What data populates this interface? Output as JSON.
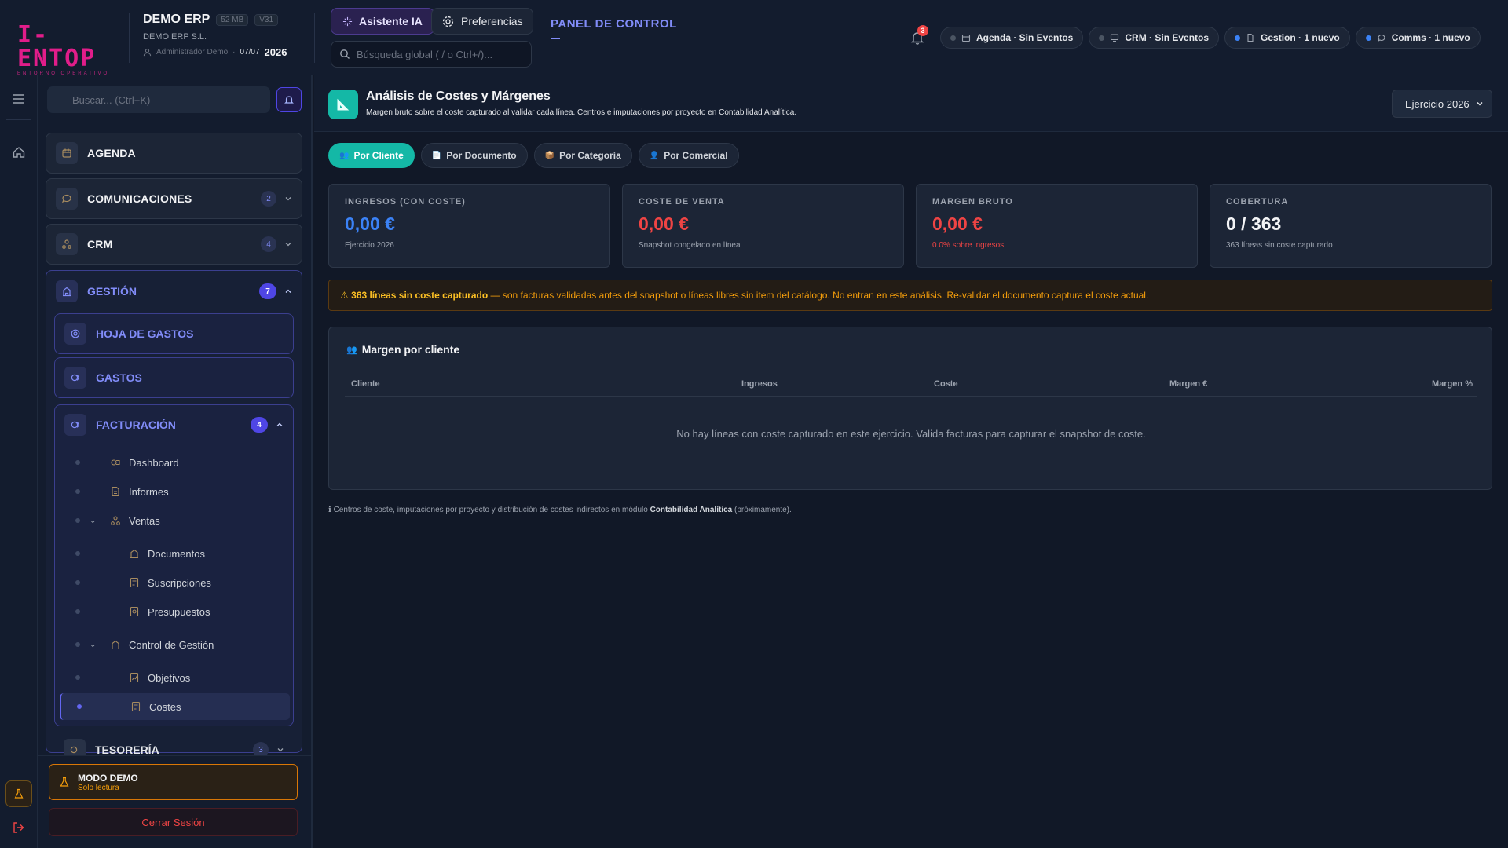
{
  "header": {
    "logo_text": "I-ENTOP",
    "logo_sub": "ENTORNO OPERATIVO",
    "company_name": "DEMO ERP",
    "chip_size": "52 MB",
    "chip_version": "V31",
    "company_legal": "DEMO ERP S.L.",
    "user": "Administrador Demo",
    "date": "07/07",
    "year": "2026",
    "ai_button": "Asistente IA",
    "prefs_button": "Preferencias",
    "search_placeholder": "Búsqueda global ( / o Ctrl+/)...",
    "panel_title": "PANEL DE CONTROL",
    "notif_count": "3",
    "pills": [
      {
        "label": "Agenda · Sin Eventos",
        "dot": "gray"
      },
      {
        "label": "CRM · Sin Eventos",
        "dot": "gray"
      },
      {
        "label": "Gestion · 1 nuevo",
        "dot": "blue"
      },
      {
        "label": "Comms · 1 nuevo",
        "dot": "blue"
      }
    ]
  },
  "sidebar": {
    "search_placeholder": "Buscar... (Ctrl+K)",
    "modules": {
      "agenda": {
        "label": "AGENDA"
      },
      "comunicaciones": {
        "label": "COMUNICACIONES",
        "count": "2"
      },
      "crm": {
        "label": "CRM",
        "count": "4"
      },
      "gestion": {
        "label": "GESTIÓN",
        "count": "7"
      },
      "hoja_gastos": {
        "label": "HOJA DE GASTOS"
      },
      "gastos": {
        "label": "GASTOS"
      },
      "facturacion": {
        "label": "FACTURACIÓN",
        "count": "4"
      },
      "tesoreria": {
        "label": "TESORERÍA",
        "count": "3"
      }
    },
    "tree": {
      "dashboard": "Dashboard",
      "informes": "Informes",
      "ventas": "Ventas",
      "documentos": "Documentos",
      "suscripciones": "Suscripciones",
      "presupuestos": "Presupuestos",
      "control": "Control de Gestión",
      "objetivos": "Objetivos",
      "costes": "Costes"
    },
    "demo_title": "MODO DEMO",
    "demo_sub": "Solo lectura",
    "logout": "Cerrar Sesión"
  },
  "page": {
    "title": "Análisis de Costes y Márgenes",
    "subtitle": "Margen bruto sobre el coste capturado al validar cada línea. Centros e imputaciones por proyecto en Contabilidad Analítica.",
    "exercise": "Ejercicio 2026",
    "tabs": [
      {
        "label": "Por Cliente",
        "icon": "users-icon"
      },
      {
        "label": "Por Documento",
        "icon": "document-icon"
      },
      {
        "label": "Por Categoría",
        "icon": "box-icon"
      },
      {
        "label": "Por Comercial",
        "icon": "person-icon"
      }
    ],
    "kpis": [
      {
        "label": "INGRESOS (CON COSTE)",
        "value": "0,00 €",
        "note": "Ejercicio 2026",
        "color": "#3b82f6"
      },
      {
        "label": "COSTE DE VENTA",
        "value": "0,00 €",
        "note": "Snapshot congelado en línea",
        "color": "#ef4444"
      },
      {
        "label": "MARGEN BRUTO",
        "value": "0,00 €",
        "note": "0.0% sobre ingresos",
        "color": "#ef4444"
      },
      {
        "label": "COBERTURA",
        "value": "0 / 363",
        "note": "363 líneas sin coste capturado",
        "color": "#f3f4f6"
      }
    ],
    "warning_bold": "⚠ 363 líneas sin coste capturado",
    "warning_text": " — son facturas validadas antes del snapshot o líneas libres sin item del catálogo. No entran en este análisis. Re-validar el documento captura el coste actual.",
    "card_title": "Margen por cliente",
    "columns": [
      "Cliente",
      "Ingresos",
      "Coste",
      "Margen €",
      "Margen %"
    ],
    "empty_text": "No hay líneas con coste capturado en este ejercicio. Valida facturas para capturar el snapshot de coste.",
    "foot_prefix": "ℹ Centros de coste, imputaciones por proyecto y distribución de costes indirectos en módulo ",
    "foot_bold": "Contabilidad Analítica",
    "foot_suffix": " (próximamente)."
  }
}
